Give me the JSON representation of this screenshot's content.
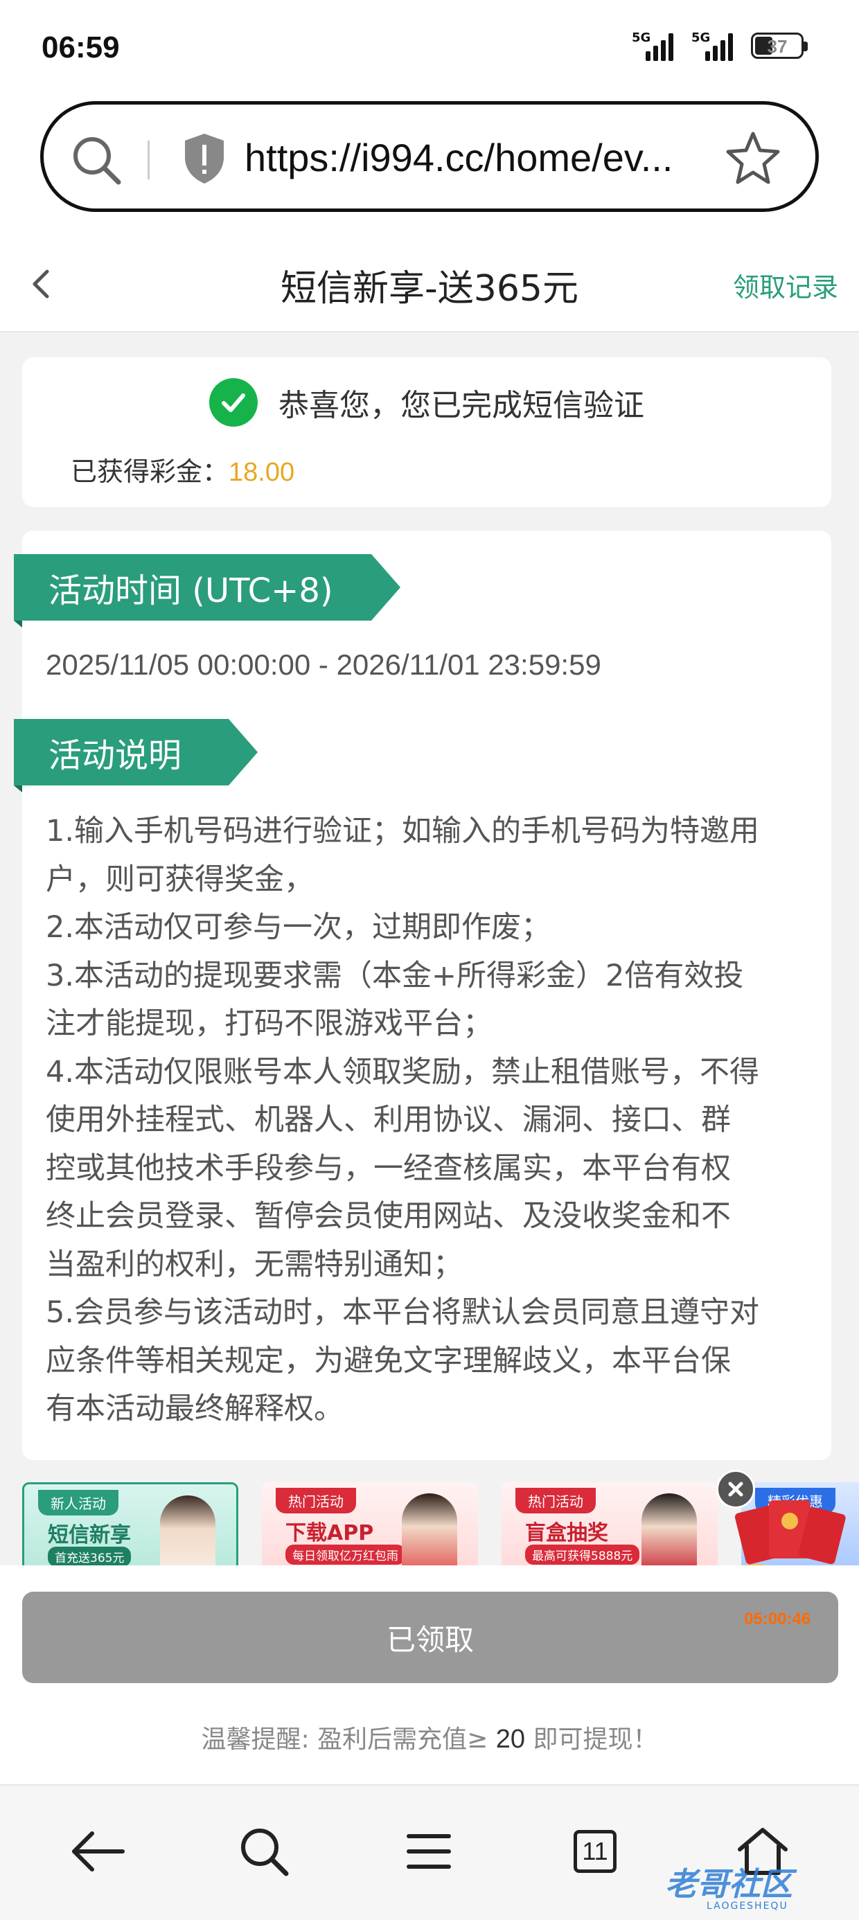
{
  "status_bar": {
    "time": "06:59",
    "signal1_label": "5G",
    "signal2_label": "5G",
    "battery": "37"
  },
  "browser": {
    "url": "https://i994.cc/home/ev...",
    "search_icon": "search-icon",
    "shield_icon": "shield-icon",
    "star_icon": "star-icon"
  },
  "header": {
    "title": "短信新享-送365元",
    "record_link": "领取记录"
  },
  "verify": {
    "message": "恭喜您，您已完成短信验证",
    "bonus_label": "已获得彩金：",
    "bonus_value": "18.00"
  },
  "activity": {
    "time_heading": "活动时间 (UTC+8)",
    "time_range": "2025/11/05 00:00:00 - 2026/11/01 23:59:59",
    "desc_heading": "活动说明",
    "rule_lines": [
      "1.输入手机号码进行验证；如输入的手机号码为特邀用",
      "户，则可获得奖金，",
      "2.本活动仅可参与一次，过期即作废；",
      "3.本活动的提现要求需（本金+所得彩金）2倍有效投",
      "注才能提现，打码不限游戏平台；",
      "4.本活动仅限账号本人领取奖励，禁止租借账号，不得",
      "使用外挂程式、机器人、利用协议、漏洞、接口、群",
      "控或其他技术手段参与，一经查核属实，本平台有权",
      "终止会员登录、暂停会员使用网站、及没收奖金和不",
      "当盈利的权利，无需特别通知；",
      "5.会员参与该活动时，本平台将默认会员同意且遵守对",
      "应条件等相关规定，为避免文字理解歧义，本平台保",
      "有本活动最终解释权。"
    ]
  },
  "promos": [
    {
      "tag": "新人活动",
      "title": "短信新享",
      "sub": "首充送365元"
    },
    {
      "tag": "热门活动",
      "title": "下载APP",
      "sub": "每日领取亿万红包雨"
    },
    {
      "tag": "热门活动",
      "title": "盲盒抽奖",
      "sub": "最高可获得5888元"
    },
    {
      "tag": "精彩优惠",
      "title": "",
      "sub": ""
    }
  ],
  "floating": {
    "timer": "05:00:46"
  },
  "action": {
    "claimed_label": "已领取",
    "reminder_prefix": "温馨提醒: 盈利后需充值≥ ",
    "reminder_amount": "20",
    "reminder_suffix": " 即可提现！"
  },
  "bottom_nav": {
    "tabs_count": "11"
  },
  "watermark": {
    "text": "老哥社区",
    "sub": "LAOGESHEQU"
  }
}
